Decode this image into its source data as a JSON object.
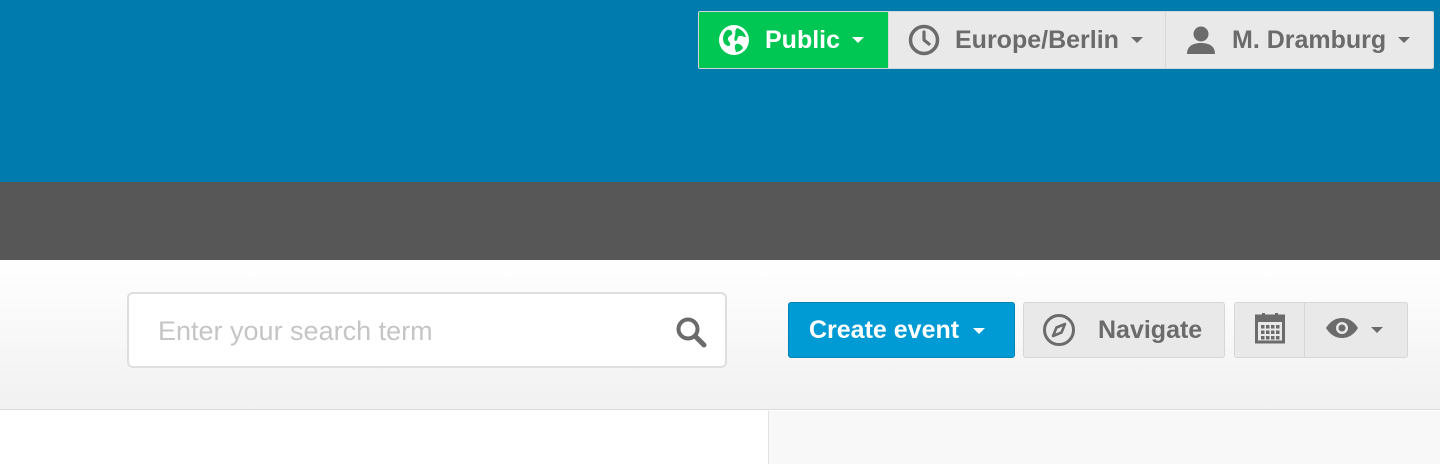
{
  "colors": {
    "header_blue": "#007bad",
    "dark_band": "#575757",
    "public_green": "#00c653",
    "create_blue": "#009bd4",
    "button_grey": "#e9e9e9",
    "text_grey": "#6b6b6b"
  },
  "user_bar": {
    "visibility": {
      "label": "Public",
      "icon": "globe-icon"
    },
    "timezone": {
      "label": "Europe/Berlin",
      "icon": "clock-icon"
    },
    "user": {
      "label": "M. Dramburg",
      "icon": "user-icon"
    }
  },
  "search": {
    "placeholder": "Enter your search term",
    "value": "",
    "icon": "search-icon"
  },
  "toolbar": {
    "create_label": "Create event",
    "navigate_label": "Navigate",
    "navigate_icon": "compass-icon",
    "calendar_icon": "calendar-icon",
    "view_icon": "eye-icon"
  }
}
